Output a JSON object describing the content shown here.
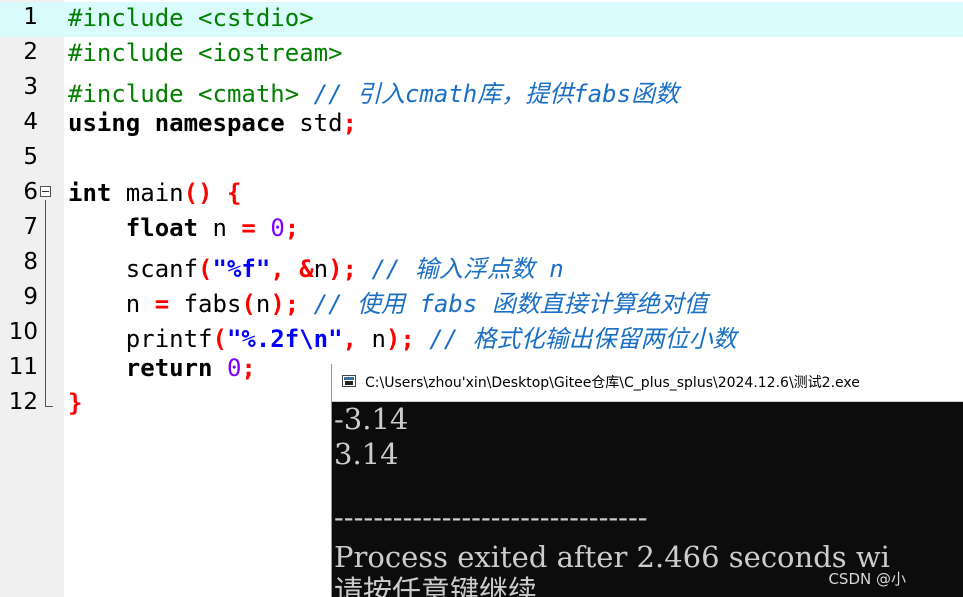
{
  "editor": {
    "line_numbers": [
      "1",
      "2",
      "3",
      "4",
      "5",
      "6",
      "7",
      "8",
      "9",
      "10",
      "11",
      "12"
    ],
    "line1": {
      "include": "#include <cstdio>"
    },
    "line2": {
      "include": "#include <iostream>"
    },
    "line3": {
      "include": "#include <cmath>",
      "comment": "// 引入cmath库，提供fabs函数"
    },
    "line4": {
      "kw_using": "using",
      "kw_namespace": "namespace",
      "name": " std",
      "semi": ";"
    },
    "line6": {
      "kw_int": "int",
      "name": " main",
      "parens": "()",
      "brace": "{"
    },
    "line7": {
      "kw_float": "float",
      "name": " n ",
      "eq": "=",
      "num": "0",
      "semi": ";"
    },
    "line8": {
      "fn": "scanf",
      "lp": "(",
      "fmt": "\"%f\"",
      "comma": ",",
      "amp": "&",
      "var": "n",
      "rp": ");",
      "comment": "// 输入浮点数 n"
    },
    "line9": {
      "lhs": "n ",
      "eq": "=",
      "fn": " fabs",
      "lp": "(",
      "var": "n",
      "rp": ");",
      "comment": "// 使用 fabs 函数直接计算绝对值"
    },
    "line10": {
      "fn": "printf",
      "lp": "(",
      "fmt": "\"%.2f\\n\"",
      "comma": ",",
      "var": " n",
      "rp": ");",
      "comment": "// 格式化输出保留两位小数"
    },
    "line11": {
      "kw_return": "return",
      "num": "0",
      "semi": ";"
    },
    "line12": {
      "brace": "}"
    }
  },
  "console": {
    "title": "C:\\Users\\zhou'xin\\Desktop\\Gitee仓库\\C_plus_splus\\2024.12.6\\测试2.exe",
    "lines": [
      "-3.14",
      "3.14",
      "",
      "--------------------------------",
      "Process exited after 2.466 seconds wi",
      "请按任意键继续. . ."
    ]
  },
  "watermark": "CSDN @小",
  "colors": {
    "current_line": "#d9fbfb",
    "preprocessor": "#007f00",
    "punctuation": "#ff0000",
    "number": "#8000ff",
    "string": "#0000ff",
    "comment": "#1a6fc4",
    "console_bg": "#0c0c0c"
  }
}
